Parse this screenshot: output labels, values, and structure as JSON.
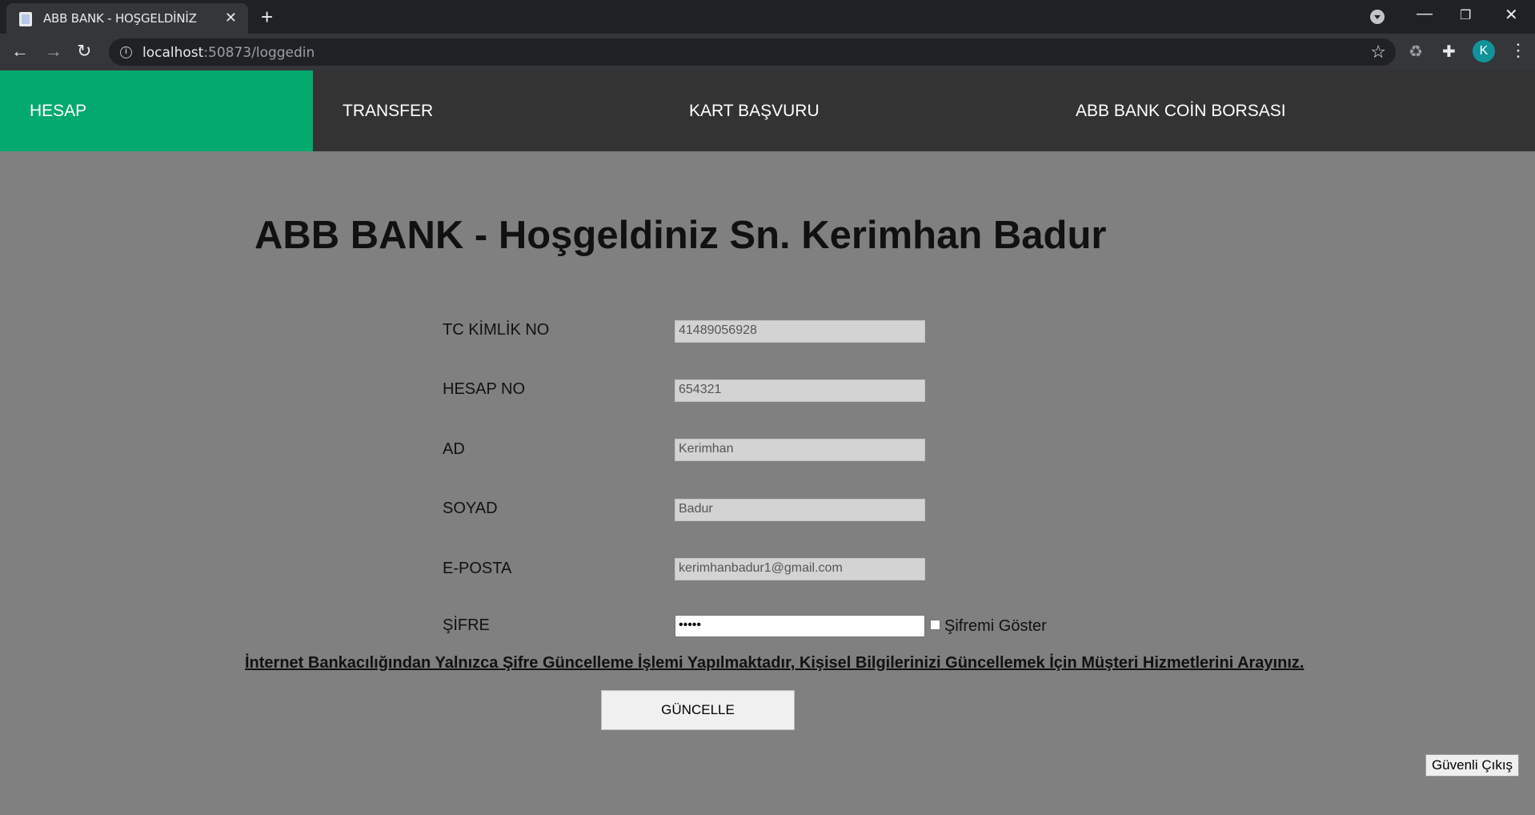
{
  "browser": {
    "tab_title": "ABB BANK - HOŞGELDİNİZ",
    "url_host": "localhost",
    "url_path": ":50873/loggedin"
  },
  "nav": {
    "items": [
      {
        "label": "HESAP",
        "active": true
      },
      {
        "label": "TRANSFER",
        "active": false
      },
      {
        "label": "KART BAŞVURU",
        "active": false
      },
      {
        "label": "ABB BANK COİN BORSASI",
        "active": false
      }
    ],
    "active_color": "#04aa6d",
    "bg_color": "#333333"
  },
  "page": {
    "title": "ABB BANK - Hoşgeldiniz Sn. Kerimhan Badur"
  },
  "form": {
    "fields": [
      {
        "label": "TC KİMLİK NO",
        "value": "41489056928"
      },
      {
        "label": "HESAP NO",
        "value": "654321"
      },
      {
        "label": "AD",
        "value": "Kerimhan"
      },
      {
        "label": "SOYAD",
        "value": "Badur"
      },
      {
        "label": "E-POSTA",
        "value": "kerimhanbadur1@gmail.com"
      }
    ],
    "password_label": "ŞİFRE",
    "password_value": "•••••",
    "show_password_label": "Şifremi Göster",
    "notice": "İnternet Bankacılığından Yalnızca Şifre Güncelleme İşlemi Yapılmaktadır, Kişisel Bilgilerinizi Güncellemek İçin Müşteri Hizmetlerini Arayınız.",
    "update_button": "GÜNCELLE"
  },
  "logout_button": "Güvenli Çıkış",
  "avatar_letter": "K"
}
